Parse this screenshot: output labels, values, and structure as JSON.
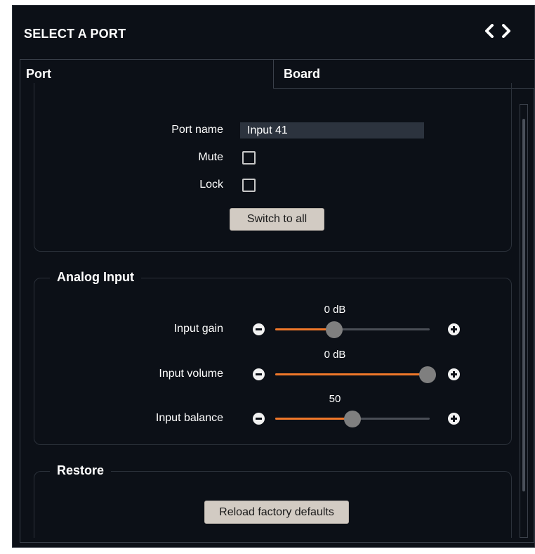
{
  "header": {
    "title": "SELECT A PORT",
    "prev_icon": "chevron-left-icon",
    "next_icon": "chevron-right-icon"
  },
  "tabs": [
    {
      "label": "Port",
      "active": true
    },
    {
      "label": "Board",
      "active": false
    }
  ],
  "port_settings": {
    "port_name_label": "Port name",
    "port_name_value": "Input 41",
    "mute_label": "Mute",
    "mute_checked": false,
    "lock_label": "Lock",
    "lock_checked": false,
    "switch_button": "Switch to all"
  },
  "analog_input": {
    "legend": "Analog Input",
    "sliders": [
      {
        "label": "Input gain",
        "value_text": "0 dB",
        "level": 0.38
      },
      {
        "label": "Input volume",
        "value_text": "0 dB",
        "level": 1.0
      },
      {
        "label": "Input balance",
        "value_text": "50",
        "level": 0.5
      }
    ]
  },
  "restore": {
    "legend": "Restore",
    "button": "Reload factory defaults"
  },
  "colors": {
    "background": "#0c1017",
    "accent": "#f0782a",
    "button": "#d2cbc3"
  }
}
